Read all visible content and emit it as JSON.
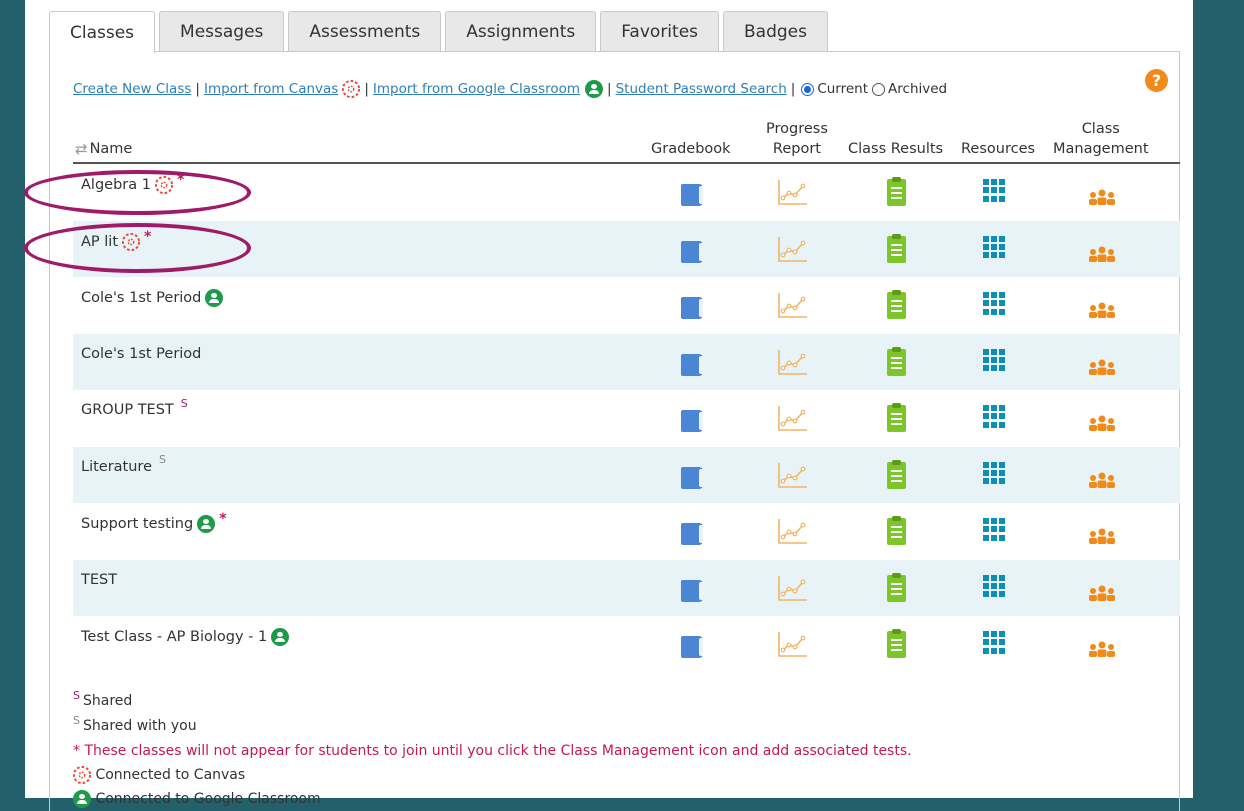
{
  "tabs": [
    "Classes",
    "Messages",
    "Assessments",
    "Assignments",
    "Favorites",
    "Badges"
  ],
  "active_tab": "Classes",
  "toolbar": {
    "create_class": "Create New Class",
    "import_canvas": "Import from Canvas",
    "import_google": "Import from Google Classroom",
    "student_password_search": "Student Password Search",
    "current": "Current",
    "archived": "Archived",
    "separator": "|"
  },
  "help_label": "?",
  "columns": {
    "name": "Name",
    "gradebook": "Gradebook",
    "progress_1": "Progress",
    "progress_2": "Report",
    "class_results": "Class Results",
    "resources": "Resources",
    "mgmt_1": "Class",
    "mgmt_2": "Management"
  },
  "rows": [
    {
      "name": "Algebra 1",
      "canvas": true,
      "google": false,
      "star": "*",
      "shared": ""
    },
    {
      "name": "AP lit",
      "canvas": true,
      "google": false,
      "star": "*",
      "shared": ""
    },
    {
      "name": "Cole's 1st Period",
      "canvas": false,
      "google": true,
      "star": "",
      "shared": ""
    },
    {
      "name": "Cole's 1st Period",
      "canvas": false,
      "google": false,
      "star": "",
      "shared": ""
    },
    {
      "name": "GROUP TEST",
      "canvas": false,
      "google": false,
      "star": "",
      "shared": "S"
    },
    {
      "name": "Literature",
      "canvas": false,
      "google": false,
      "star": "",
      "shared_with": "S"
    },
    {
      "name": "Support testing",
      "canvas": false,
      "google": true,
      "star": "*",
      "shared": ""
    },
    {
      "name": "TEST",
      "canvas": false,
      "google": false,
      "star": "",
      "shared": ""
    },
    {
      "name": "Test Class - AP Biology - 1",
      "canvas": false,
      "google": true,
      "star": "",
      "shared": ""
    }
  ],
  "footnotes": {
    "shared_mark": "S",
    "shared": "Shared",
    "shared_with_mark": "S",
    "shared_with": "Shared with you",
    "star_note": "* These classes will not appear for students to join until you click the Class Management icon and add associated tests.",
    "canvas": "Connected to Canvas",
    "google": "Connected to Google Classroom"
  },
  "colors": {
    "background": "#24606b",
    "link": "#2f7fb5",
    "alt_row": "#e8f3f8",
    "highlight_oval": "#a01a6a",
    "gradebook": "#4a86d4",
    "progress": "#f3b463",
    "results": "#7cc52a",
    "resources": "#0d8fb5",
    "management": "#f08a1a"
  }
}
